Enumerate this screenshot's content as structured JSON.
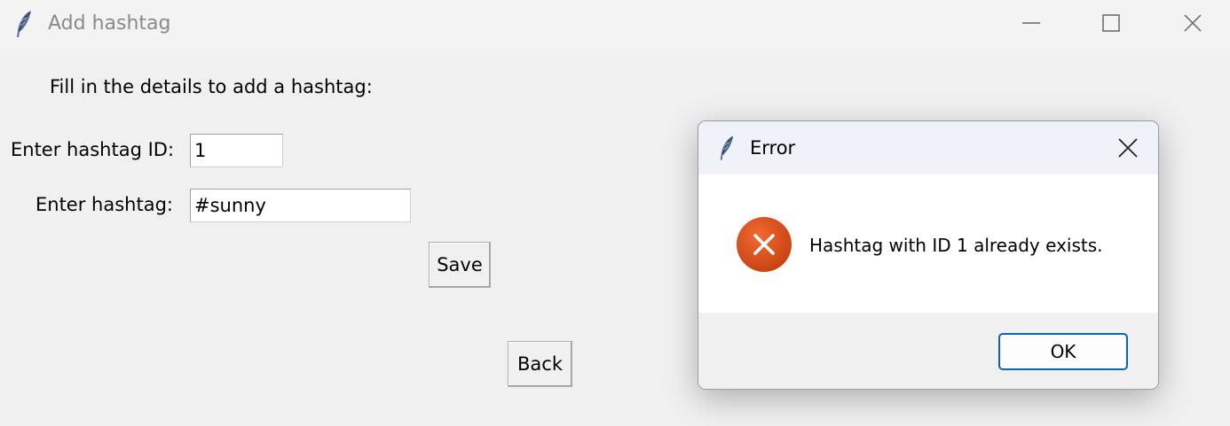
{
  "window": {
    "title": "Add hashtag",
    "icon": "feather-icon"
  },
  "form": {
    "instruction": "Fill in the details to add a hashtag:",
    "id_label": "Enter hashtag ID:",
    "id_value": "1",
    "hashtag_label": "Enter hashtag:",
    "hashtag_value": "#sunny",
    "save_label": "Save",
    "back_label": "Back"
  },
  "dialog": {
    "title": "Error",
    "icon": "error-icon",
    "message": "Hashtag with ID 1 already exists.",
    "ok_label": "OK"
  },
  "colors": {
    "error_red": "#d8481a",
    "accent": "#0a63c4",
    "window_bg": "#f0f0f0"
  }
}
